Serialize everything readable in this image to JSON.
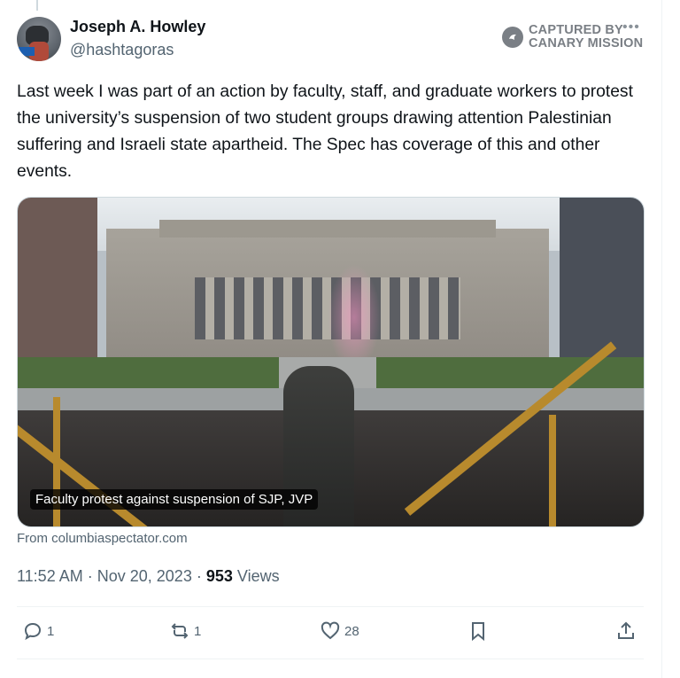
{
  "author": {
    "name": "Joseph A. Howley",
    "handle": "@hashtagoras"
  },
  "badge": {
    "line1": "CAPTURED BY",
    "line2": "CANARY MISSION"
  },
  "tweet": {
    "text": "Last week I was part of an action by faculty, staff, and graduate workers to protest the university’s suspension of two student groups drawing attention Palestinian suffering and Israeli state apartheid. The Spec has coverage of this and other events."
  },
  "media": {
    "caption": "Faculty protest against suspension of SJP, JVP",
    "source": "From columbiaspectator.com"
  },
  "meta": {
    "time": "11:52 AM",
    "separator": "·",
    "date": "Nov 20, 2023",
    "views_count": "953",
    "views_label": "Views"
  },
  "actions": {
    "replies": "1",
    "reposts": "1",
    "likes": "28"
  },
  "icons": [
    "reply-icon",
    "repost-icon",
    "like-icon",
    "bookmark-icon",
    "share-icon",
    "more-icon",
    "canary-mission-icon"
  ]
}
